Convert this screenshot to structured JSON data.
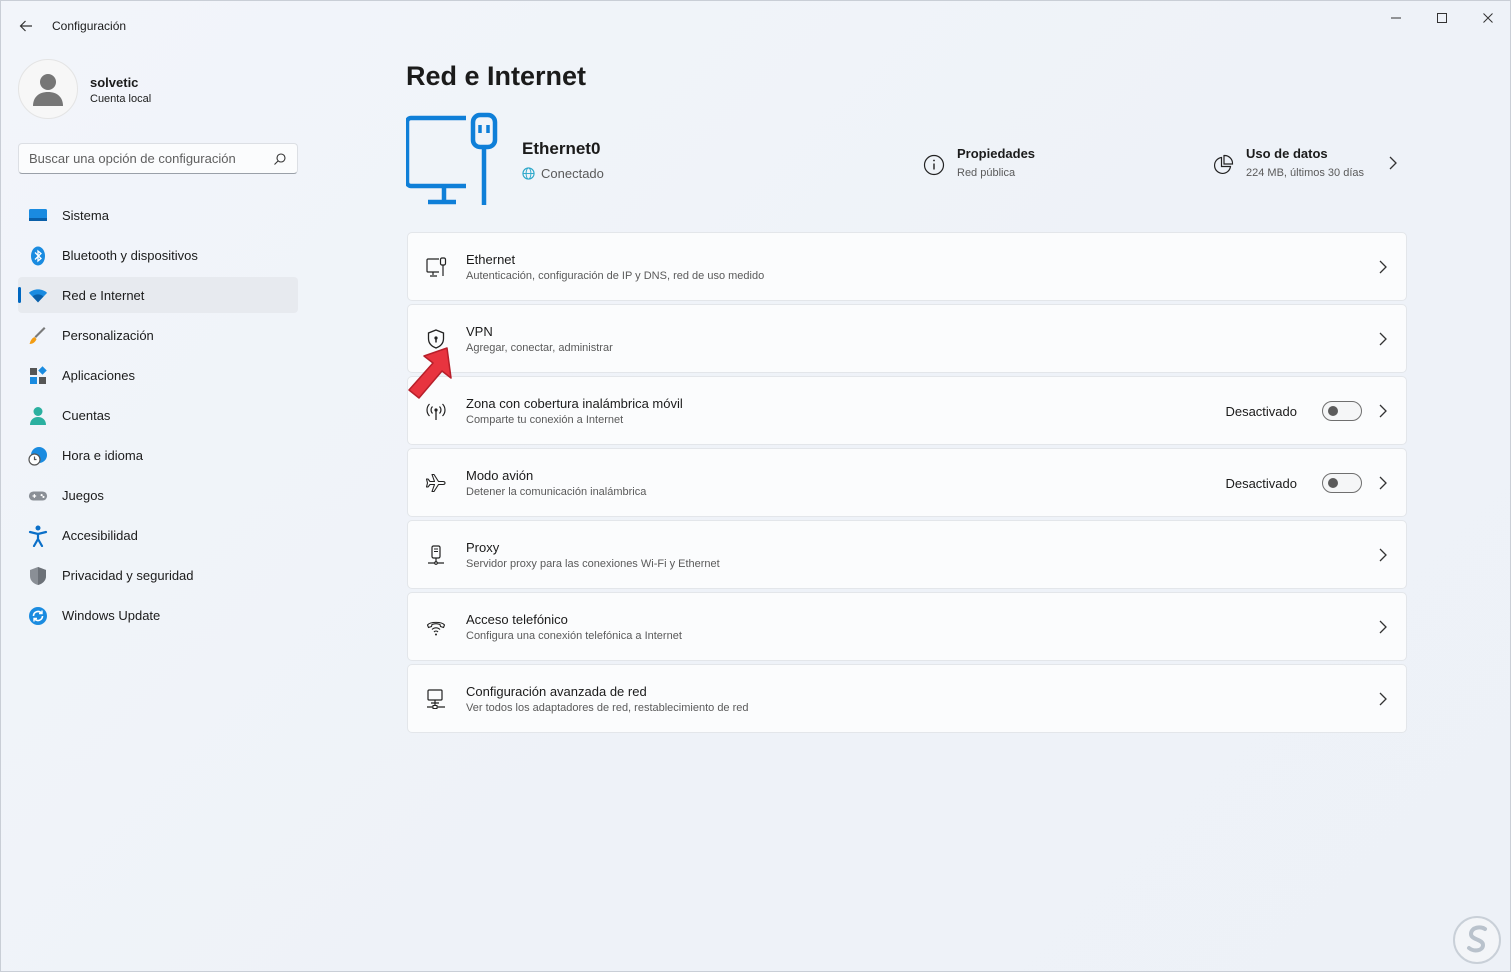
{
  "window": {
    "title": "Configuración",
    "controls": {
      "minimize": "minimize",
      "maximize": "maximize",
      "close": "close"
    }
  },
  "profile": {
    "name": "solvetic",
    "account_type": "Cuenta local"
  },
  "search": {
    "placeholder": "Buscar una opción de configuración"
  },
  "sidebar": {
    "items": [
      {
        "label": "Sistema",
        "icon": "system-icon"
      },
      {
        "label": "Bluetooth y dispositivos",
        "icon": "bluetooth-icon"
      },
      {
        "label": "Red e Internet",
        "icon": "wifi-icon",
        "active": true
      },
      {
        "label": "Personalización",
        "icon": "brush-icon"
      },
      {
        "label": "Aplicaciones",
        "icon": "apps-icon"
      },
      {
        "label": "Cuentas",
        "icon": "person-icon"
      },
      {
        "label": "Hora e idioma",
        "icon": "clock-globe-icon"
      },
      {
        "label": "Juegos",
        "icon": "gamepad-icon"
      },
      {
        "label": "Accesibilidad",
        "icon": "accessibility-icon"
      },
      {
        "label": "Privacidad y seguridad",
        "icon": "shield-icon"
      },
      {
        "label": "Windows Update",
        "icon": "update-icon"
      }
    ]
  },
  "main": {
    "title": "Red e Internet",
    "connection": {
      "name": "Ethernet0",
      "status": "Conectado"
    },
    "properties": {
      "title": "Propiedades",
      "subtitle": "Red pública"
    },
    "data_usage": {
      "title": "Uso de datos",
      "subtitle": "224 MB, últimos 30 días"
    },
    "cards": [
      {
        "title": "Ethernet",
        "subtitle": "Autenticación, configuración de IP y DNS, red de uso medido",
        "icon": "ethernet-icon"
      },
      {
        "title": "VPN",
        "subtitle": "Agregar, conectar, administrar",
        "icon": "vpn-shield-icon"
      },
      {
        "title": "Zona con cobertura inalámbrica móvil",
        "subtitle": "Comparte tu conexión a Internet",
        "icon": "hotspot-icon",
        "toggle": "Desactivado"
      },
      {
        "title": "Modo avión",
        "subtitle": "Detener la comunicación inalámbrica",
        "icon": "airplane-icon",
        "toggle": "Desactivado"
      },
      {
        "title": "Proxy",
        "subtitle": "Servidor proxy para las conexiones Wi-Fi y Ethernet",
        "icon": "proxy-icon"
      },
      {
        "title": "Acceso telefónico",
        "subtitle": "Configura una conexión telefónica a Internet",
        "icon": "dialup-icon"
      },
      {
        "title": "Configuración avanzada de red",
        "subtitle": "Ver todos los adaptadores de red, restablecimiento de red",
        "icon": "advanced-network-icon"
      }
    ]
  },
  "colors": {
    "accent": "#0067c0",
    "arrow": "#e8343f",
    "hero_icon": "#0f7fd8"
  }
}
